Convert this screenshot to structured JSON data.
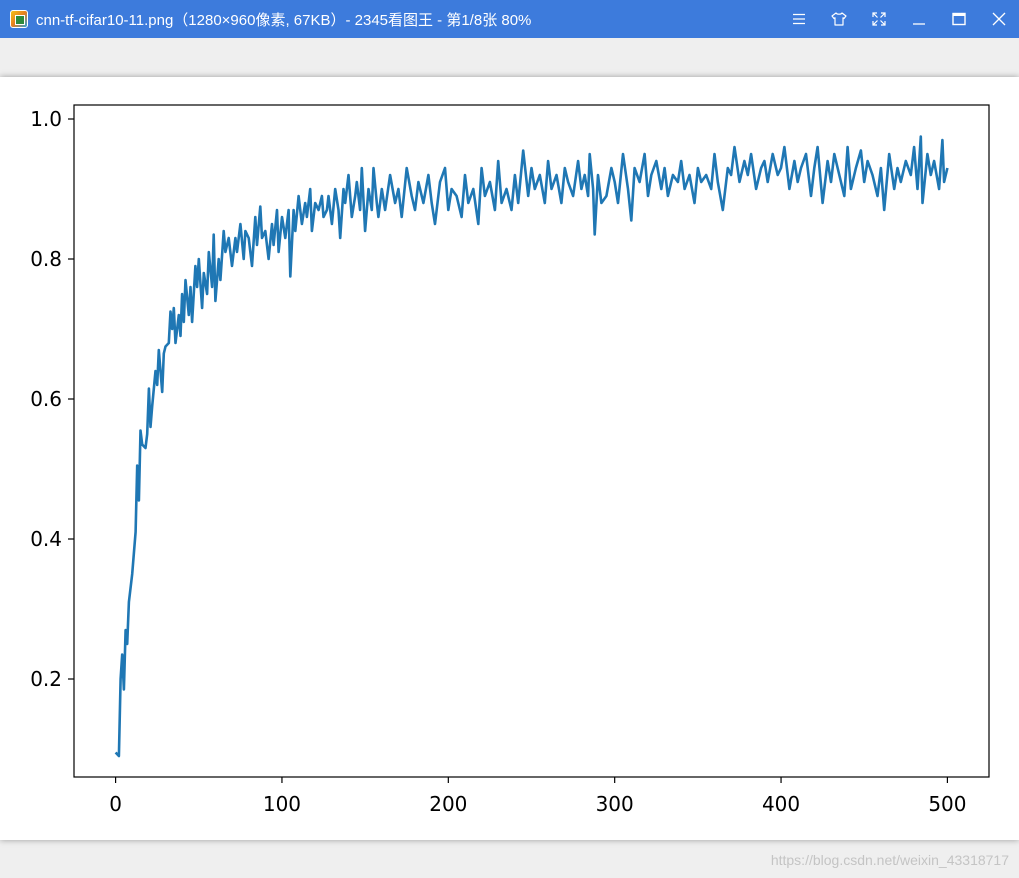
{
  "window": {
    "title": "cnn-tf-cifar10-11.png（1280×960像素, 67KB）- 2345看图王 - 第1/8张 80%",
    "app_icon": "image-viewer-icon",
    "controls": [
      "menu-icon",
      "skin-icon",
      "fullscreen-icon",
      "minimize-icon",
      "maximize-icon",
      "close-icon"
    ],
    "accent_color": "#3d7bdc"
  },
  "watermark": "https://blog.csdn.net/weixin_43318717",
  "chart_data": {
    "type": "line",
    "title": "",
    "xlabel": "",
    "ylabel": "",
    "xlim": [
      -25,
      525
    ],
    "ylim": [
      0.06,
      1.02
    ],
    "xticks": [
      0,
      100,
      200,
      300,
      400,
      500
    ],
    "xtick_labels": [
      "0",
      "100",
      "200",
      "300",
      "400",
      "500"
    ],
    "yticks": [
      0.2,
      0.4,
      0.6,
      0.8,
      1.0
    ],
    "ytick_labels": [
      "0.2",
      "0.4",
      "0.6",
      "0.8",
      "1.0"
    ],
    "grid": false,
    "line_color": "#1f77b4",
    "x": [
      0,
      2,
      3,
      4,
      5,
      6,
      7,
      8,
      10,
      12,
      13,
      14,
      15,
      16,
      18,
      19,
      20,
      21,
      22,
      24,
      25,
      26,
      28,
      29,
      30,
      32,
      33,
      34,
      35,
      36,
      38,
      39,
      40,
      41,
      42,
      44,
      45,
      46,
      48,
      49,
      50,
      52,
      53,
      55,
      56,
      58,
      59,
      60,
      62,
      63,
      65,
      66,
      68,
      70,
      72,
      73,
      75,
      77,
      78,
      80,
      82,
      84,
      85,
      87,
      88,
      90,
      92,
      94,
      95,
      97,
      98,
      100,
      102,
      104,
      105,
      107,
      108,
      110,
      112,
      114,
      115,
      117,
      118,
      120,
      122,
      124,
      125,
      127,
      128,
      130,
      132,
      134,
      135,
      137,
      138,
      140,
      142,
      144,
      145,
      147,
      148,
      150,
      152,
      154,
      155,
      157,
      158,
      160,
      162,
      165,
      168,
      170,
      172,
      175,
      178,
      180,
      182,
      185,
      188,
      190,
      192,
      195,
      198,
      200,
      202,
      205,
      208,
      210,
      212,
      215,
      218,
      220,
      222,
      225,
      228,
      230,
      232,
      235,
      238,
      240,
      242,
      245,
      248,
      250,
      252,
      255,
      258,
      260,
      262,
      265,
      268,
      270,
      272,
      275,
      278,
      280,
      282,
      284,
      285,
      287,
      288,
      290,
      292,
      295,
      298,
      300,
      302,
      305,
      308,
      310,
      312,
      315,
      318,
      320,
      322,
      325,
      328,
      330,
      332,
      335,
      338,
      340,
      342,
      345,
      348,
      350,
      352,
      355,
      358,
      360,
      362,
      365,
      368,
      370,
      372,
      375,
      378,
      380,
      382,
      385,
      388,
      390,
      392,
      395,
      398,
      400,
      402,
      405,
      408,
      410,
      412,
      415,
      418,
      420,
      422,
      425,
      428,
      430,
      432,
      435,
      438,
      440,
      442,
      445,
      448,
      450,
      452,
      455,
      458,
      460,
      462,
      465,
      468,
      470,
      472,
      475,
      478,
      480,
      482,
      484,
      485,
      488,
      490,
      492,
      495,
      497,
      498,
      500
    ],
    "y": [
      0.095,
      0.09,
      0.2,
      0.235,
      0.185,
      0.27,
      0.25,
      0.31,
      0.35,
      0.41,
      0.505,
      0.455,
      0.555,
      0.535,
      0.53,
      0.55,
      0.615,
      0.56,
      0.59,
      0.64,
      0.62,
      0.67,
      0.61,
      0.665,
      0.675,
      0.68,
      0.725,
      0.7,
      0.73,
      0.68,
      0.72,
      0.69,
      0.75,
      0.71,
      0.77,
      0.72,
      0.76,
      0.71,
      0.79,
      0.76,
      0.8,
      0.73,
      0.78,
      0.75,
      0.81,
      0.76,
      0.835,
      0.74,
      0.8,
      0.77,
      0.84,
      0.81,
      0.83,
      0.79,
      0.83,
      0.81,
      0.85,
      0.8,
      0.84,
      0.83,
      0.79,
      0.86,
      0.82,
      0.875,
      0.83,
      0.84,
      0.8,
      0.85,
      0.82,
      0.87,
      0.81,
      0.86,
      0.83,
      0.87,
      0.775,
      0.87,
      0.84,
      0.89,
      0.85,
      0.88,
      0.86,
      0.9,
      0.84,
      0.88,
      0.87,
      0.89,
      0.86,
      0.87,
      0.89,
      0.85,
      0.9,
      0.87,
      0.83,
      0.9,
      0.88,
      0.92,
      0.86,
      0.89,
      0.91,
      0.87,
      0.93,
      0.84,
      0.9,
      0.87,
      0.93,
      0.88,
      0.86,
      0.9,
      0.87,
      0.92,
      0.88,
      0.9,
      0.86,
      0.93,
      0.89,
      0.87,
      0.91,
      0.88,
      0.92,
      0.88,
      0.85,
      0.91,
      0.93,
      0.87,
      0.9,
      0.89,
      0.86,
      0.92,
      0.88,
      0.9,
      0.85,
      0.93,
      0.89,
      0.91,
      0.87,
      0.94,
      0.88,
      0.9,
      0.87,
      0.92,
      0.88,
      0.955,
      0.89,
      0.93,
      0.9,
      0.92,
      0.88,
      0.94,
      0.9,
      0.92,
      0.88,
      0.93,
      0.91,
      0.89,
      0.94,
      0.9,
      0.92,
      0.89,
      0.95,
      0.9,
      0.835,
      0.92,
      0.88,
      0.89,
      0.93,
      0.91,
      0.88,
      0.95,
      0.9,
      0.855,
      0.93,
      0.91,
      0.95,
      0.89,
      0.92,
      0.94,
      0.9,
      0.93,
      0.89,
      0.92,
      0.91,
      0.94,
      0.9,
      0.92,
      0.88,
      0.93,
      0.91,
      0.92,
      0.9,
      0.95,
      0.91,
      0.87,
      0.93,
      0.92,
      0.96,
      0.91,
      0.94,
      0.92,
      0.95,
      0.9,
      0.93,
      0.94,
      0.91,
      0.95,
      0.92,
      0.93,
      0.96,
      0.9,
      0.94,
      0.91,
      0.93,
      0.95,
      0.89,
      0.93,
      0.96,
      0.88,
      0.94,
      0.91,
      0.95,
      0.92,
      0.89,
      0.96,
      0.9,
      0.93,
      0.955,
      0.91,
      0.94,
      0.92,
      0.89,
      0.93,
      0.87,
      0.95,
      0.9,
      0.93,
      0.91,
      0.94,
      0.92,
      0.96,
      0.9,
      0.975,
      0.88,
      0.95,
      0.92,
      0.94,
      0.9,
      0.97,
      0.91,
      0.93,
      0.925
    ]
  }
}
